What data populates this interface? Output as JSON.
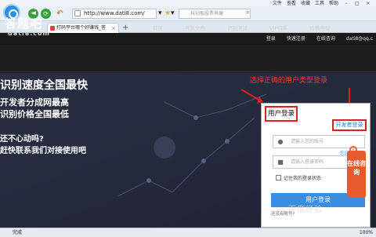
{
  "browser": {
    "url": "http://www.dati8.com/",
    "search_placeholder": "科创板股票再爆",
    "menu": [
      "文件",
      "查看",
      "收藏",
      "工具",
      "帮助"
    ],
    "tab_title": "打码平台哪个好赚钱_答",
    "status": "完成",
    "zoom": "100%"
  },
  "site": {
    "topstrip_links": [
      "登录",
      "快速注册",
      "在线咨询",
      "dati8@qq.c"
    ],
    "logo": "答题吧",
    "logo_sub": "dati8.com",
    "nav": [
      "首页",
      "开发文档",
      "识别测试",
      "VIP特系",
      "价格类型"
    ],
    "hero_lines": [
      "识别速度全国最快",
      "开发者分成网最高",
      "识别价格全国最低",
      "还不心动吗?",
      "赶快联系我们对接使用吧"
    ],
    "annotation": "选择正确的用户类型登录"
  },
  "login": {
    "title": "用户登录",
    "developer_login": "开发者登录",
    "username_placeholder": "请输入您的账号",
    "password_placeholder": "请输入登录密码",
    "forgot": "忘记密码?",
    "remember": "记住我的登录状态",
    "button": "用户登录",
    "register": "还没有账号?"
  },
  "side_bubble": "在线咨询",
  "watermark": "百度经验"
}
